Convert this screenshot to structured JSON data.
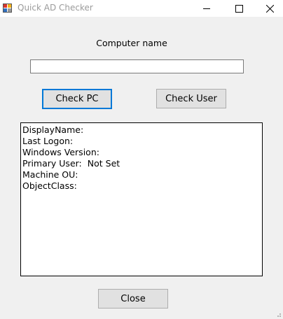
{
  "window": {
    "title": "Quick AD Checker"
  },
  "titlebar_buttons": {
    "minimize_icon": "minimize-icon",
    "maximize_icon": "maximize-icon",
    "close_icon": "close-icon"
  },
  "form": {
    "computer_name_label": "Computer name",
    "computer_name_value": "",
    "check_pc_label": "Check PC",
    "check_user_label": "Check User",
    "close_label": "Close"
  },
  "output": {
    "lines": [
      {
        "label": "DisplayName:",
        "value": ""
      },
      {
        "label": "Last Logon:",
        "value": ""
      },
      {
        "label": "Windows Version:",
        "value": ""
      },
      {
        "label": "Primary User:",
        "value": "Not Set"
      },
      {
        "label": "Machine OU:",
        "value": ""
      },
      {
        "label": "ObjectClass:",
        "value": ""
      }
    ]
  },
  "colors": {
    "focus_border": "#0078d7",
    "background": "#f0f0f0"
  }
}
